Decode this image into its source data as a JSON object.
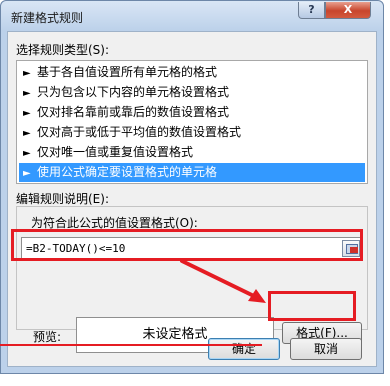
{
  "window": {
    "title": "新建格式规则"
  },
  "titlebar": {
    "help_label": "?",
    "close_label": "X"
  },
  "rule_type": {
    "label": "选择规则类型(S):",
    "items": [
      {
        "label": "基于各自值设置所有单元格的格式",
        "selected": false
      },
      {
        "label": "只为包含以下内容的单元格设置格式",
        "selected": false
      },
      {
        "label": "仅对排名靠前或靠后的数值设置格式",
        "selected": false
      },
      {
        "label": "仅对高于或低于平均值的数值设置格式",
        "selected": false
      },
      {
        "label": "仅对唯一值或重复值设置格式",
        "selected": false
      },
      {
        "label": "使用公式确定要设置格式的单元格",
        "selected": true
      }
    ],
    "arrow_glyph": "►"
  },
  "rule_desc": {
    "label": "编辑规则说明(E):",
    "formula_label": "为符合此公式的值设置格式(O):",
    "formula_value": "=B2-TODAY()<=10",
    "picker_icon": "range-picker-icon"
  },
  "preview": {
    "label": "预览:",
    "text": "未设定格式",
    "format_button": "格式(F)..."
  },
  "footer": {
    "ok_label": "确定",
    "cancel_label": "取消"
  },
  "colors": {
    "highlight": "#e51c23",
    "selected": "#3399ff",
    "window_frame": "#bcd1ea"
  }
}
